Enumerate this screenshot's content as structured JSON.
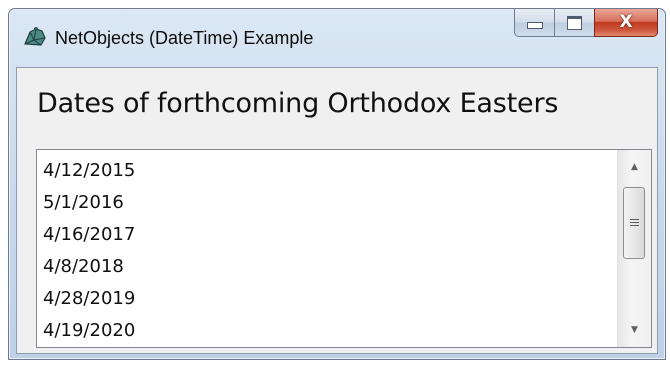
{
  "window": {
    "title": "NetObjects (DateTime) Example",
    "app_icon": "netobjects-app-icon",
    "caption_buttons": {
      "minimize_icon": "minimize-icon",
      "maximize_icon": "maximize-icon",
      "close_glyph": "X"
    }
  },
  "main": {
    "heading": "Dates of forthcoming Orthodox Easters",
    "dates": [
      "4/12/2015",
      "5/1/2016",
      "4/16/2017",
      "4/8/2018",
      "4/28/2019",
      "4/19/2020"
    ]
  },
  "scrollbar": {
    "up_arrow": "▲",
    "down_arrow": "▼"
  },
  "colors": {
    "titlebar": "#c9d9eb",
    "close_button": "#c2391f",
    "client_background": "#f0f0f0"
  }
}
